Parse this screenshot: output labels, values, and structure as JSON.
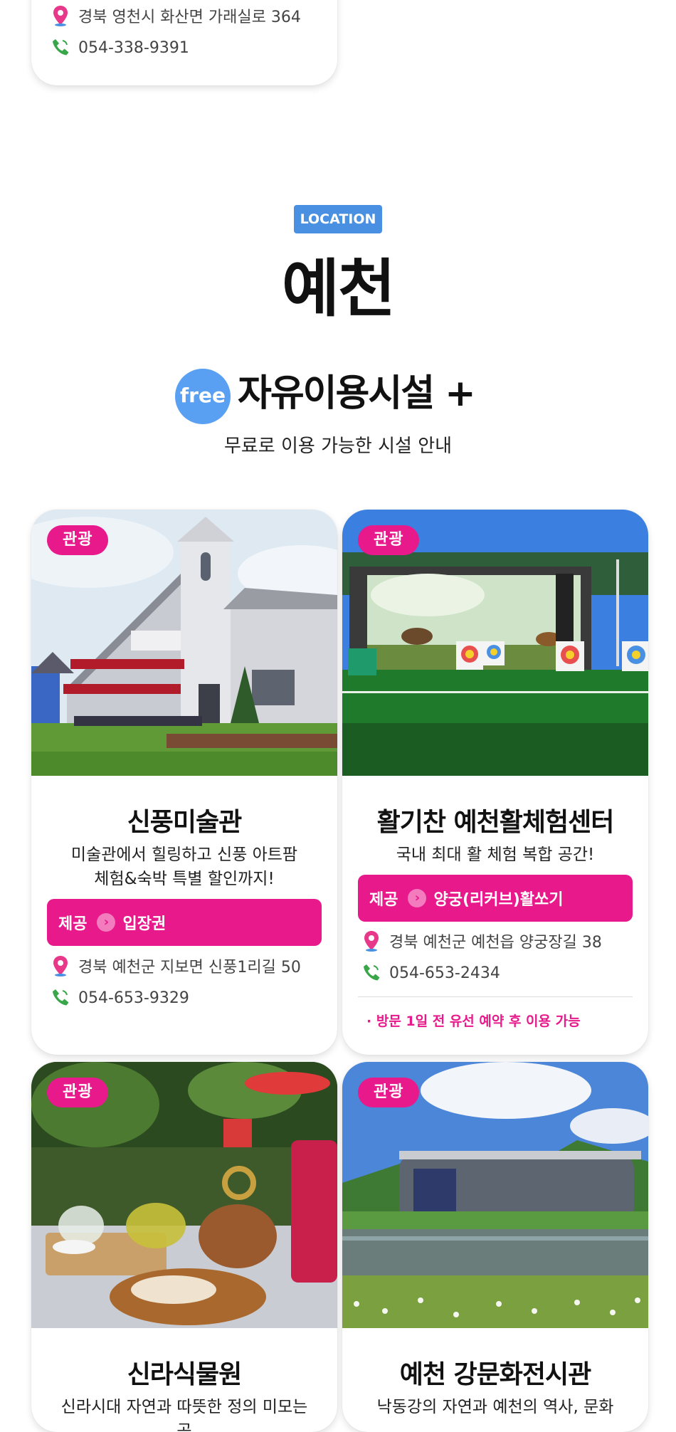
{
  "top_card": {
    "address": "경북 영천시 화산면 가래실로 364",
    "phone": "054-338-9391"
  },
  "section": {
    "location_tag": "LOCATION",
    "city": "예천",
    "free_badge": "free",
    "facility_title": "자유이용시설 +",
    "facility_subtitle": "무료로 이용 가능한 시설 안내"
  },
  "cards": [
    {
      "category": "관광",
      "title": "신풍미술관",
      "desc_line1": "미술관에서 힐링하고 신풍 아트팜",
      "desc_line2": "체험&숙박 특별 할인까지!",
      "provide_label": "제공",
      "provide_item": "입장권",
      "address": "경북 예천군 지보면 신풍1리길 50",
      "phone": "054-653-9329"
    },
    {
      "category": "관광",
      "title": "활기찬 예천활체험센터",
      "desc_line1": "국내 최대 활 체험 복합 공간!",
      "provide_label": "제공",
      "provide_item": "양궁(리커브)활쏘기",
      "address": "경북 예천군 예천읍 양궁장길 38",
      "phone": "054-653-2434",
      "note": "· 방문 1일 전 유선 예약 후 이용 가능"
    },
    {
      "category": "관광",
      "title": "신라식물원",
      "desc_line1": "신라시대 자연과 따뜻한 정의 미모는 공"
    },
    {
      "category": "관광",
      "title": "예천 강문화전시관",
      "desc_line1": "낙동강의 자연과 예천의 역사, 문화"
    }
  ],
  "colors": {
    "accent_pink": "#e8198b",
    "location_blue": "#4a90e2",
    "free_blue": "#5aa0f2"
  },
  "icons": [
    "location-pin-icon",
    "phone-icon",
    "chevron-right-icon"
  ]
}
